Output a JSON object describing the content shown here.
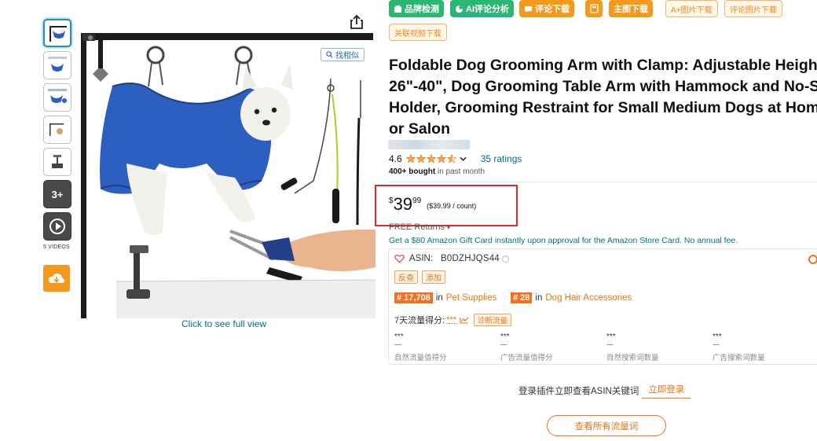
{
  "toolbar": {
    "brand_check": "品牌检测",
    "ai_review": "AI评论分析",
    "review_download": "评论下载",
    "calc_icon": "calculator-icon",
    "main_image_download": "主图下载",
    "aplus_image_download": "A+图片下载",
    "review_image_download": "评论图片下载",
    "related_video_download": "关联视频下载"
  },
  "gallery": {
    "videos_label": "5 VIDEOS",
    "more_label": "3+",
    "find_similar": "找相似",
    "click_full_view": "Click to see full view"
  },
  "product": {
    "title_lines": [
      "Foldable Dog Grooming Arm with Clamp: Adjustable Height",
      "26\"-40\", Dog Grooming Table Arm with Hammock and No-Si",
      "Holder, Grooming Restraint for Small Medium Dogs at Home",
      "or Salon"
    ],
    "rating": "4.6",
    "rating_value": 4.6,
    "ratings_count": "35 ratings",
    "bought_bold": "400+ bought",
    "bought_rest": " in past month",
    "price_symbol": "$",
    "price_whole": "39",
    "price_fraction": "99",
    "price_per_unit": "($39.99 / count)",
    "free_returns": "FREE Returns",
    "gift_card": "Get a $80 Amazon Gift Card instantly upon approval for the Amazon Store Card. No annual fee."
  },
  "plugin": {
    "asin_label": "ASIN:",
    "asin_value": "B0DZHJQS44",
    "btn_reverse": "反查",
    "btn_add": "添加",
    "rank1_badge": "# 17,708",
    "rank1_in": "in",
    "rank1_cat": "Pet Supplies",
    "rank2_badge": "# 28",
    "rank2_in": "in",
    "rank2_cat": "Dog Hair Accessories",
    "flow_label": "7天流量得分:",
    "flow_score": "***",
    "diagnose_btn": "诊断流量",
    "metrics": [
      {
        "value": "***",
        "dash": "----",
        "label": "自然流量值得分"
      },
      {
        "value": "***",
        "dash": "----",
        "label": "广告流量值得分"
      },
      {
        "value": "***",
        "dash": "----",
        "label": "自然搜索词数量"
      },
      {
        "value": "***",
        "dash": "----",
        "label": "广告搜索词数量"
      }
    ],
    "login_prompt": "登录插件立即查看ASIN关键词",
    "login_link": "立即登录",
    "view_all": "查看所有流量词"
  },
  "colors": {
    "green": "#2cb673",
    "orange": "#f39a1d",
    "price_highlight": "#e32b2b",
    "link": "#007185",
    "star": "#f3a847",
    "hammock": "#2d5fc0"
  }
}
